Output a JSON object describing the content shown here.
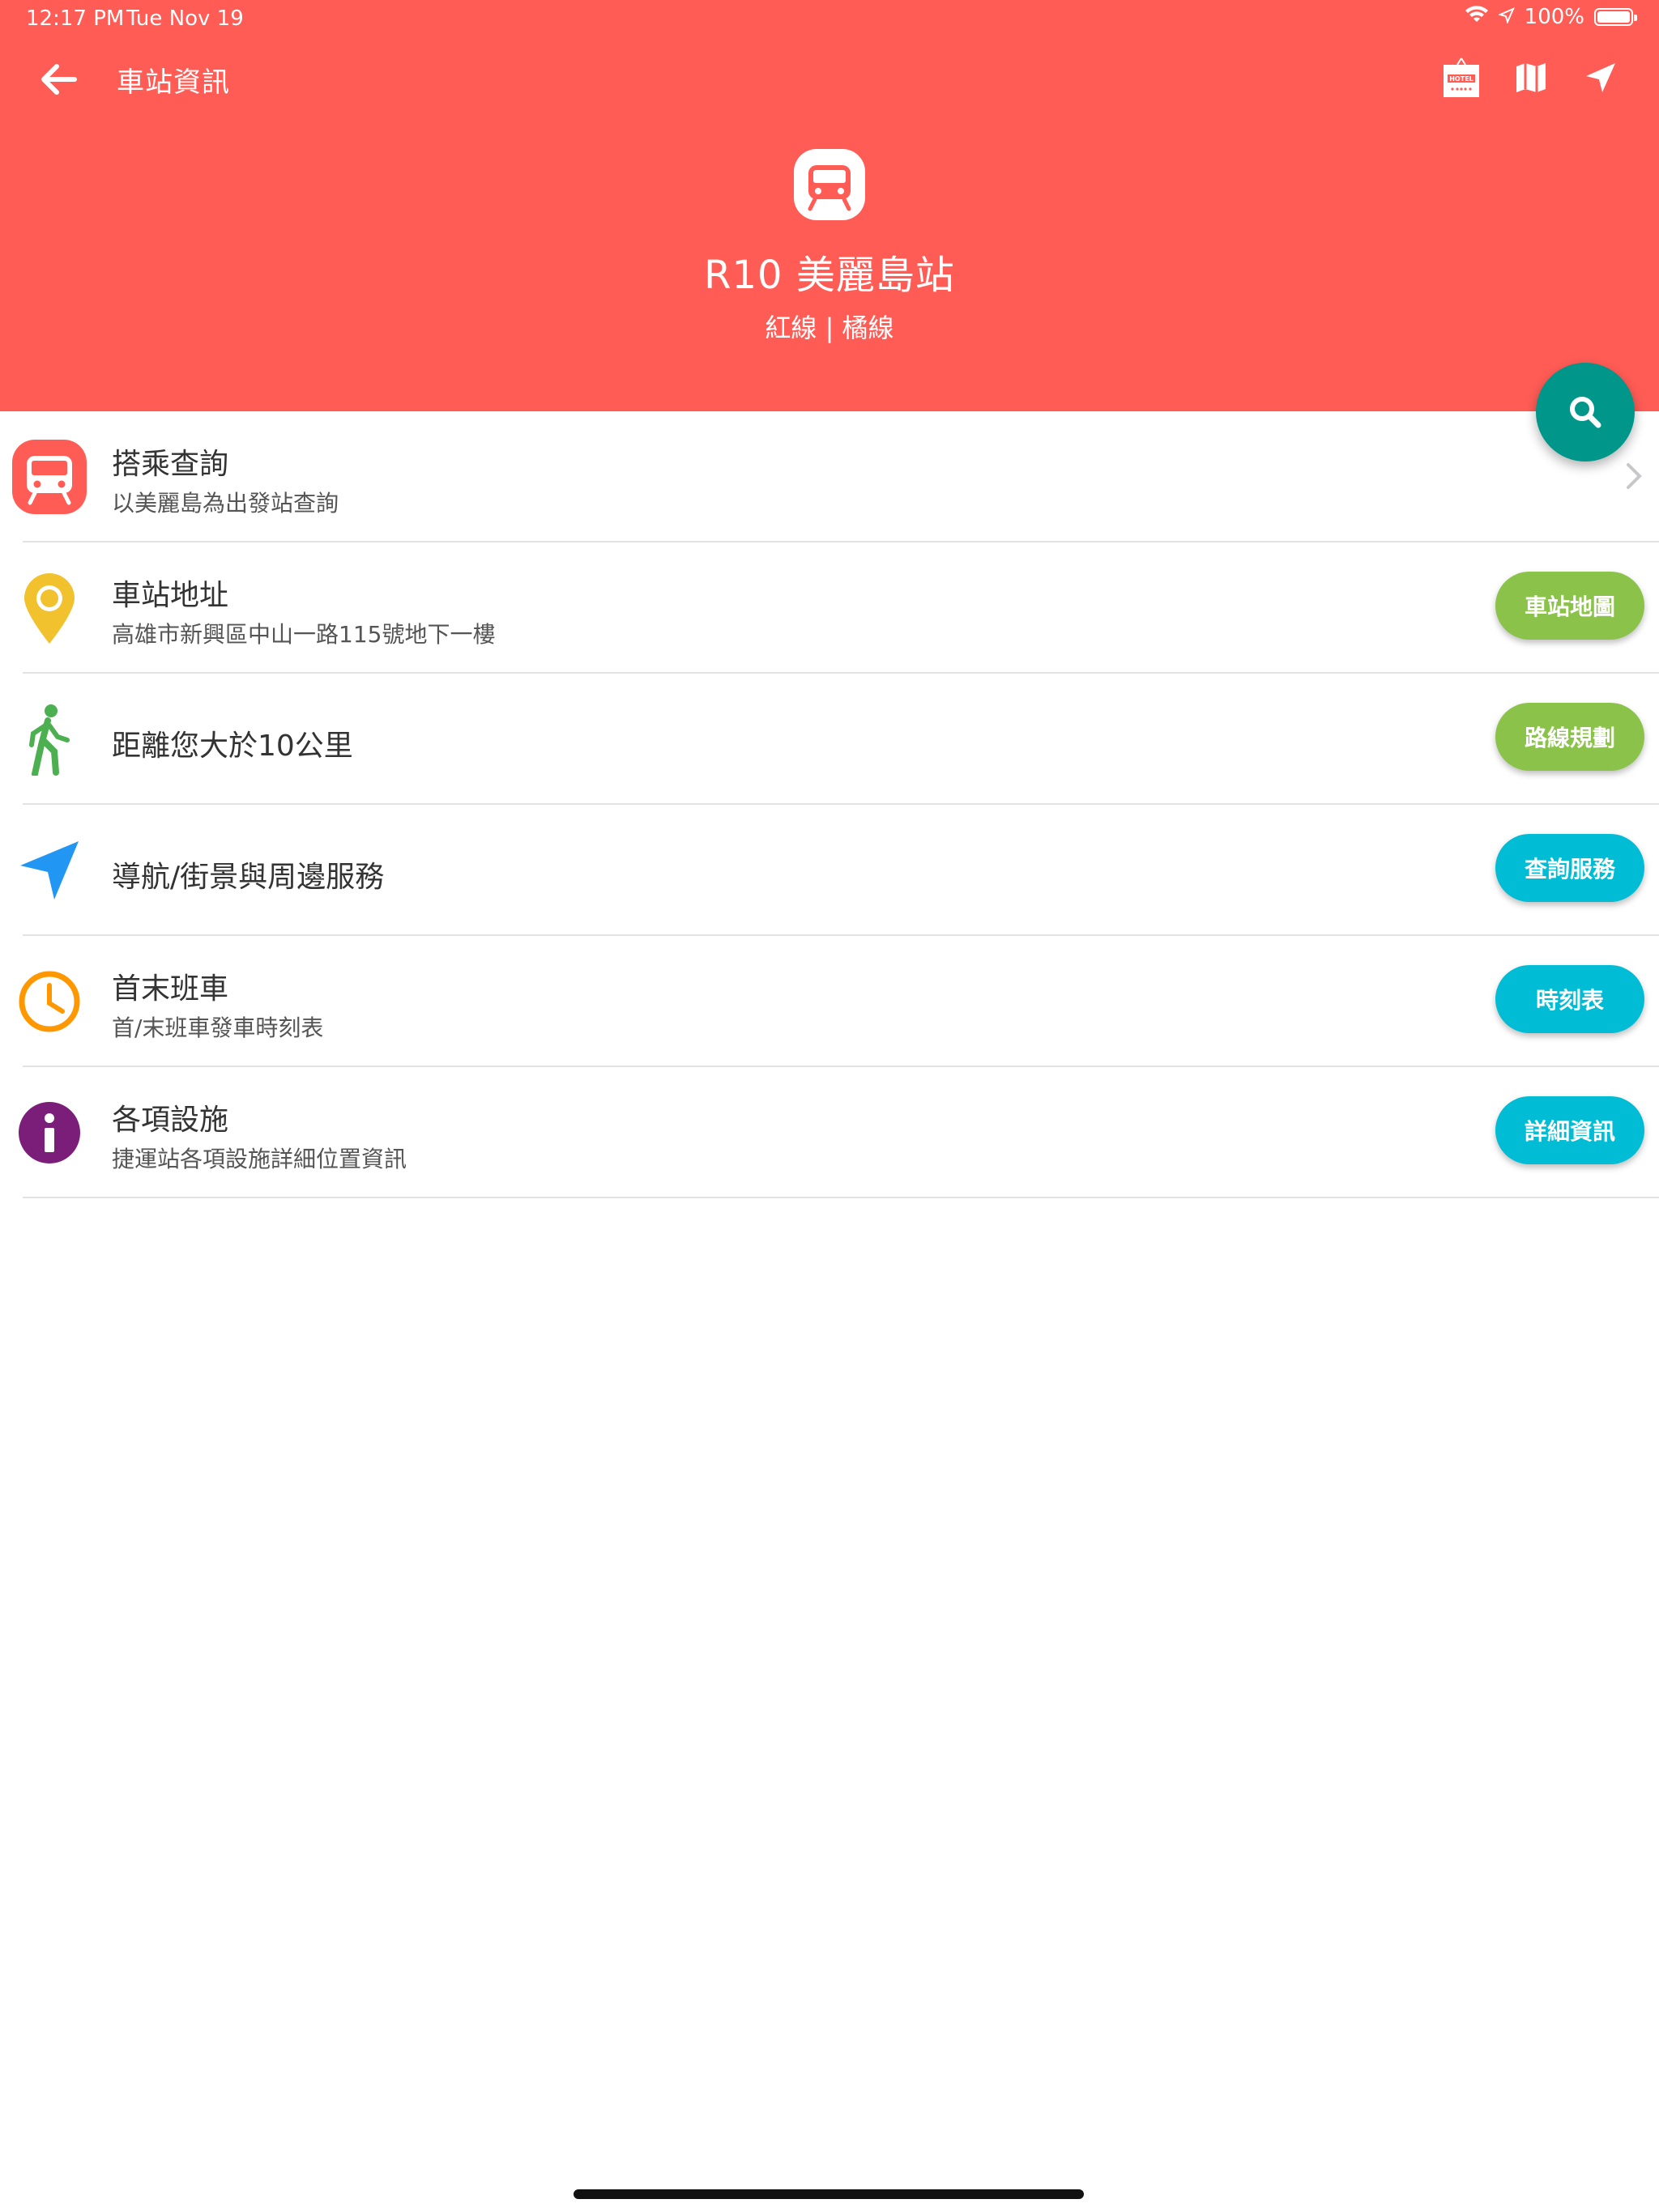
{
  "status_bar": {
    "time": "12:17 PM",
    "date": "Tue Nov 19",
    "battery": "100%"
  },
  "nav": {
    "title": "車站資訊",
    "back_icon": "arrow-left-icon",
    "action_icons": [
      "hotel-icon",
      "map-icon",
      "navigation-icon"
    ]
  },
  "station": {
    "name": "R10 美麗島站",
    "lines": "紅線 | 橘線",
    "icon": "train-icon"
  },
  "fab": {
    "icon": "search-icon",
    "color": "#00968a"
  },
  "rows": [
    {
      "title": "搭乘查詢",
      "subtitle": "以美麗島為出發站查詢",
      "icon": "train-icon",
      "icon_color": "#ff5c55",
      "action": "chevron-right-icon"
    },
    {
      "title": "車站地址",
      "subtitle": "高雄市新興區中山一路115號地下一樓",
      "icon": "map-pin-icon",
      "icon_color": "#f2c12e",
      "button": "車站地圖",
      "button_color": "#8bc34a"
    },
    {
      "title": "距離您大於10公里",
      "icon": "walking-icon",
      "icon_color": "#4caf50",
      "button": "路線規劃",
      "button_color": "#8bc34a"
    },
    {
      "title": "導航/街景與周邊服務",
      "icon": "navigation-arrow-icon",
      "icon_color": "#2196f3",
      "button": "查詢服務",
      "button_color": "#00bcd4"
    },
    {
      "title": "首末班車",
      "subtitle": "首/末班車發車時刻表",
      "icon": "clock-icon",
      "icon_color": "#ff9800",
      "button": "時刻表",
      "button_color": "#00bcd4"
    },
    {
      "title": "各項設施",
      "subtitle": "捷運站各項設施詳細位置資訊",
      "icon": "info-icon",
      "icon_color": "#7b1e7a",
      "button": "詳細資訊",
      "button_color": "#00bcd4"
    }
  ],
  "colors": {
    "header": "#ff5c55"
  }
}
